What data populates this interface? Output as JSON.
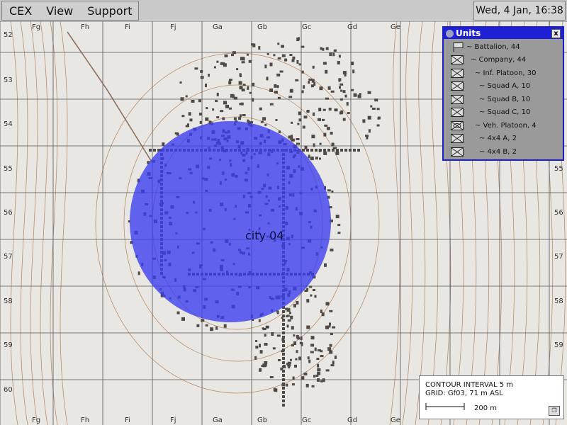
{
  "menu": {
    "items": [
      "CEX",
      "View",
      "Support"
    ]
  },
  "clock": "Wed, 4 Jan, 16:38",
  "map": {
    "columns": [
      "Fg",
      "Fh",
      "Fi",
      "Fj",
      "Ga",
      "Gb",
      "Gc",
      "Gd",
      "Ge"
    ],
    "rows": [
      "52",
      "53",
      "54",
      "55",
      "56",
      "57",
      "58",
      "59",
      "60"
    ],
    "city_label": "city 04",
    "zone_color": "#3a3cf0"
  },
  "units_window": {
    "title": "Units",
    "close_label": "x",
    "units": [
      {
        "label": "~ Battalion, 44",
        "indent": 0,
        "icon": "hq-flag-icon"
      },
      {
        "label": "~ Company, 44",
        "indent": 1,
        "icon": "infantry-icon"
      },
      {
        "label": "~ Inf. Platoon, 30",
        "indent": 2,
        "icon": "infantry-icon"
      },
      {
        "label": "~ Squad A, 10",
        "indent": 3,
        "icon": "infantry-icon"
      },
      {
        "label": "~ Squad B, 10",
        "indent": 3,
        "icon": "infantry-icon"
      },
      {
        "label": "~ Squad C, 10",
        "indent": 3,
        "icon": "infantry-icon"
      },
      {
        "label": "~ Veh. Platoon, 4",
        "indent": 2,
        "icon": "vehicle-icon"
      },
      {
        "label": "~ 4x4 A, 2",
        "indent": 3,
        "icon": "infantry-icon"
      },
      {
        "label": "~ 4x4 B, 2",
        "indent": 3,
        "icon": "infantry-icon"
      }
    ]
  },
  "legend": {
    "contour": "CONTOUR INTERVAL 5 m",
    "grid": "GRID: Gf03, 71 m ASL",
    "scale": "200 m",
    "restore_icon": "restore-icon"
  }
}
